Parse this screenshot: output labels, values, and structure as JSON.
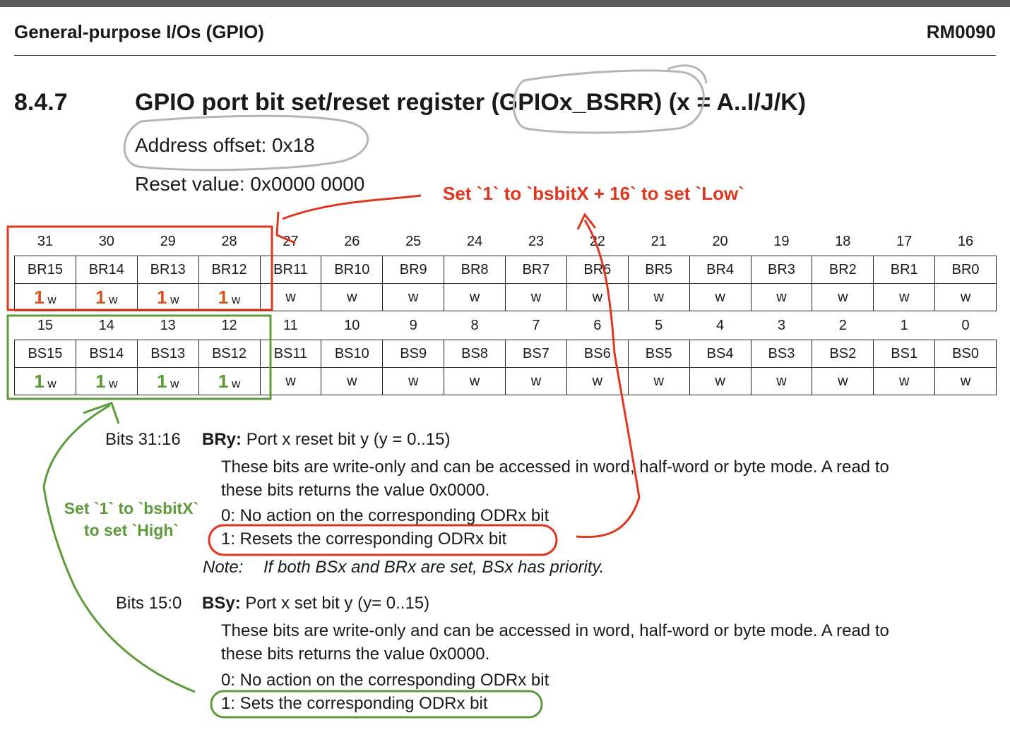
{
  "header": {
    "chapter": "General-purpose I/Os (GPIO)",
    "doc_id": "RM0090"
  },
  "section": {
    "number": "8.4.7",
    "title": "GPIO port bit set/reset register (GPIOx_BSRR) (x = A..I/J/K)",
    "address_offset": "Address offset: 0x18",
    "reset_value": "Reset value: 0x0000 0000"
  },
  "register": {
    "high_bit_numbers": [
      "31",
      "30",
      "29",
      "28",
      "27",
      "26",
      "25",
      "24",
      "23",
      "22",
      "21",
      "20",
      "19",
      "18",
      "17",
      "16"
    ],
    "high_fields": [
      "BR15",
      "BR14",
      "BR13",
      "BR12",
      "BR11",
      "BR10",
      "BR9",
      "BR8",
      "BR7",
      "BR6",
      "BR5",
      "BR4",
      "BR3",
      "BR2",
      "BR1",
      "BR0"
    ],
    "low_bit_numbers": [
      "15",
      "14",
      "13",
      "12",
      "11",
      "10",
      "9",
      "8",
      "7",
      "6",
      "5",
      "4",
      "3",
      "2",
      "1",
      "0"
    ],
    "low_fields": [
      "BS15",
      "BS14",
      "BS13",
      "BS12",
      "BS11",
      "BS10",
      "BS9",
      "BS8",
      "BS7",
      "BS6",
      "BS5",
      "BS4",
      "BS3",
      "BS2",
      "BS1",
      "BS0"
    ],
    "access": "w",
    "marked_value": "1",
    "marked_count": 4
  },
  "description": {
    "br": {
      "bits": "Bits 31:16",
      "name": "BRy:",
      "summary": "Port x reset bit y (y = 0..15)",
      "line1": "These bits are write-only and can be accessed in word, half-word or byte mode. A read to",
      "line2": "these bits returns the value 0x0000.",
      "opt0": "0: No action on the corresponding ODRx bit",
      "opt1": "1: Resets the corresponding ODRx bit",
      "note_label": "Note:",
      "note_text": "If both BSx and BRx are set, BSx has priority."
    },
    "bs": {
      "bits": "Bits 15:0",
      "name": "BSy:",
      "summary": "Port x set bit y (y= 0..15)",
      "line1": "These bits are write-only and can be accessed in word, half-word or byte mode. A read to",
      "line2": "these bits returns the value 0x0000.",
      "opt0": "0: No action on the corresponding ODRx bit",
      "opt1": "1: Sets the corresponding ODRx bit"
    }
  },
  "annotations": {
    "red_text": "Set `1` to `bsbitX + 16` to set `Low`",
    "green_line1": "Set `1` to `bsbitX`",
    "green_line2": "to set `High`",
    "colors": {
      "red": "#e0351f",
      "green": "#5c9a3a",
      "gray": "#b5b5b5",
      "red_one": "#d4541c",
      "green_one": "#5a9a35"
    }
  }
}
